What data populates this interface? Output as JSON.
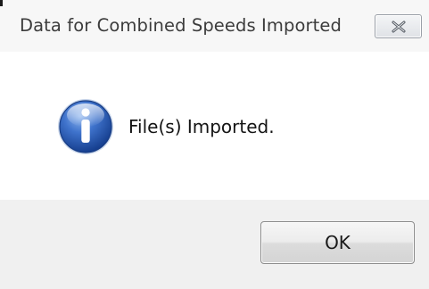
{
  "window": {
    "title": "Data for Combined Speeds Imported",
    "close_icon": "close-icon"
  },
  "dialog": {
    "icon": "info-icon",
    "message": "File(s) Imported.",
    "ok_label": "OK"
  },
  "colors": {
    "titlebar_bg": "#f7f7f7",
    "content_bg": "#ffffff",
    "footer_bg": "#f0f0f0",
    "icon_blue": "#1f4fa8"
  }
}
